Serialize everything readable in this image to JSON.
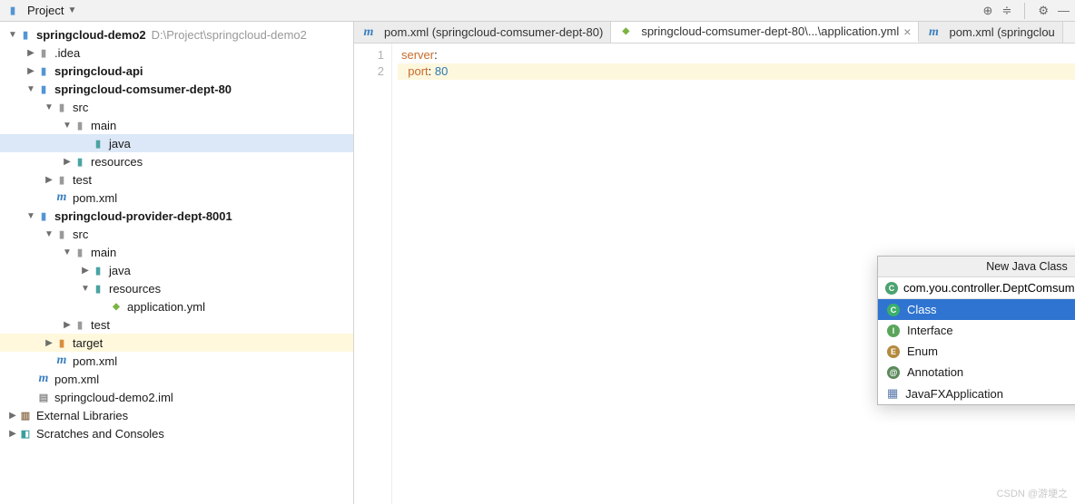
{
  "toolbar": {
    "project_label": "Project"
  },
  "tree": {
    "root": {
      "name": "springcloud-demo2",
      "path": "D:\\Project\\springcloud-demo2"
    },
    "idea": ".idea",
    "api": "springcloud-api",
    "consumer": "springcloud-comsumer-dept-80",
    "src": "src",
    "main": "main",
    "java": "java",
    "resources": "resources",
    "test": "test",
    "pom": "pom.xml",
    "provider": "springcloud-provider-dept-8001",
    "appyml": "application.yml",
    "target": "target",
    "iml": "springcloud-demo2.iml",
    "extlib": "External Libraries",
    "scratch": "Scratches and Consoles"
  },
  "tabs": [
    {
      "icon": "m",
      "label": "pom.xml (springcloud-comsumer-dept-80)"
    },
    {
      "icon": "yml",
      "label": "springcloud-comsumer-dept-80\\...\\application.yml"
    },
    {
      "icon": "m",
      "label": "pom.xml (springclou"
    }
  ],
  "code": {
    "line1_key": "server",
    "line2_key": "port",
    "line2_val": "80",
    "gutter": [
      "1",
      "2"
    ]
  },
  "popup": {
    "title": "New Java Class",
    "input": "com.you.controller.DeptComsumerController",
    "items": [
      "Class",
      "Interface",
      "Enum",
      "Annotation",
      "JavaFXApplication"
    ]
  },
  "watermark": "CSDN @游埂之"
}
